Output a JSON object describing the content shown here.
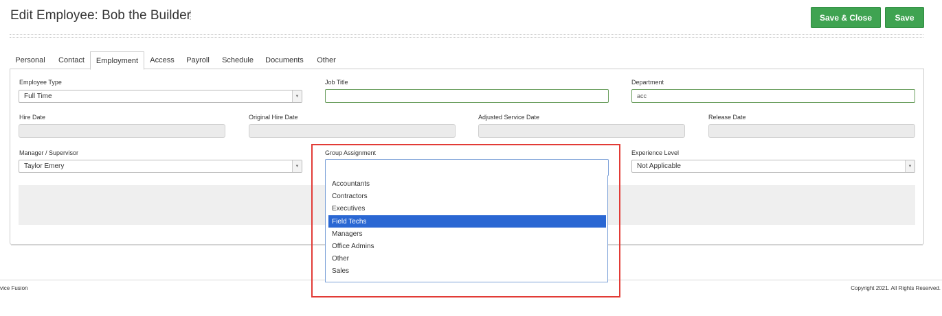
{
  "header": {
    "title": "Edit Employee: Bob the Builder",
    "save_close_label": "Save & Close",
    "save_label": "Save"
  },
  "tabs": [
    {
      "label": "Personal"
    },
    {
      "label": "Contact"
    },
    {
      "label": "Employment",
      "active": true
    },
    {
      "label": "Access"
    },
    {
      "label": "Payroll"
    },
    {
      "label": "Schedule"
    },
    {
      "label": "Documents"
    },
    {
      "label": "Other"
    }
  ],
  "form": {
    "employee_type": {
      "label": "Employee Type",
      "value": "Full Time"
    },
    "job_title": {
      "label": "Job Title",
      "value": ""
    },
    "department": {
      "label": "Department",
      "value": "acc"
    },
    "hire_date": {
      "label": "Hire Date",
      "value": ""
    },
    "original_hire_date": {
      "label": "Original Hire Date",
      "value": ""
    },
    "adjusted_service_date": {
      "label": "Adjusted Service Date",
      "value": ""
    },
    "release_date": {
      "label": "Release Date",
      "value": ""
    },
    "manager": {
      "label": "Manager / Supervisor",
      "value": "Taylor Emery"
    },
    "group_assignment": {
      "label": "Group Assignment",
      "value": "",
      "options": [
        "Accountants",
        "Contractors",
        "Executives",
        "Field Techs",
        "Managers",
        "Office Admins",
        "Other",
        "Sales"
      ],
      "highlighted": "Field Techs"
    },
    "experience_level": {
      "label": "Experience Level",
      "value": "Not Applicable"
    }
  },
  "footer": {
    "left_text": "vice Fusion",
    "right_text": "Copyright 2021. All Rights Reserved."
  },
  "colors": {
    "primary_button": "#3fa351",
    "highlight": "#2a67d3",
    "annotation_box": "#e23b36"
  },
  "icons": {
    "select_arrow": "triangle-down-icon"
  }
}
